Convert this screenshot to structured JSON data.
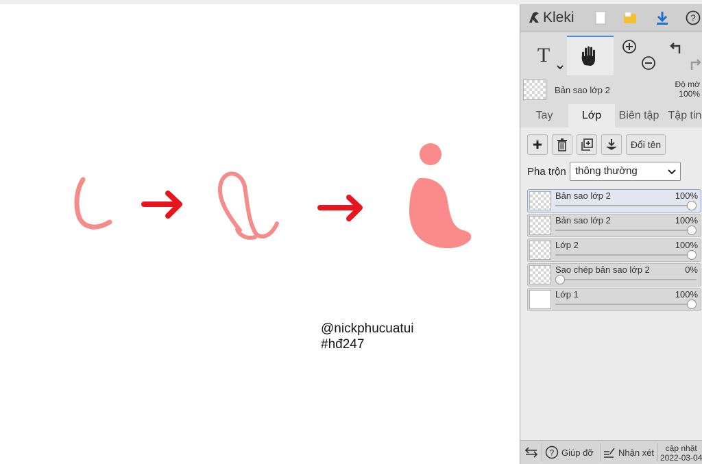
{
  "canvas": {
    "caption_line1": "@nickphucuatui",
    "caption_line2": "#hđ247",
    "stroke_color": "#f48c8c",
    "arrow_color": "#e8151d"
  },
  "sidebar": {
    "app_name": "Kleki",
    "top_icons": [
      "new-file-icon",
      "open-folder-icon",
      "download-icon",
      "help-icon"
    ],
    "tools": {
      "text_glyph": "T",
      "icons": [
        "text-tool-icon",
        "hand-tool-icon",
        "zoom-in-icon",
        "zoom-out-icon",
        "undo-icon",
        "redo-icon"
      ]
    },
    "current_layer": {
      "name": "Bản sao lớp 2",
      "opacity_label": "Độ mờ",
      "opacity_value": "100%"
    },
    "tabs": [
      {
        "label": "Tay"
      },
      {
        "label": "Lớp"
      },
      {
        "label": "Biên tập"
      },
      {
        "label": "Tập tin"
      }
    ],
    "layer_actions": {
      "icons": [
        "add-layer-icon",
        "delete-layer-icon",
        "duplicate-layer-icon",
        "merge-down-icon"
      ],
      "rename_label": "Đổi tên"
    },
    "blend": {
      "label": "Pha trộn",
      "value": "thông thường"
    },
    "layers": [
      {
        "name": "Bản sao lớp 2",
        "opacity": "100%",
        "opacity_value": 1.0,
        "selected": true
      },
      {
        "name": "Bản sao lớp 2",
        "opacity": "100%",
        "opacity_value": 1.0,
        "selected": false
      },
      {
        "name": "Lớp 2",
        "opacity": "100%",
        "opacity_value": 1.0,
        "selected": false
      },
      {
        "name": "Sao chép bản sao lớp 2",
        "opacity": "0%",
        "opacity_value": 0.0,
        "selected": false
      },
      {
        "name": "Lớp 1",
        "opacity": "100%",
        "opacity_value": 1.0,
        "selected": false
      }
    ],
    "footer": {
      "swap_icon": "swap-arrows-icon",
      "help_label": "Giúp đỡ",
      "feedback_label": "Nhận xét",
      "update_label": "cập nhật",
      "update_date": "2022-03-04"
    }
  }
}
